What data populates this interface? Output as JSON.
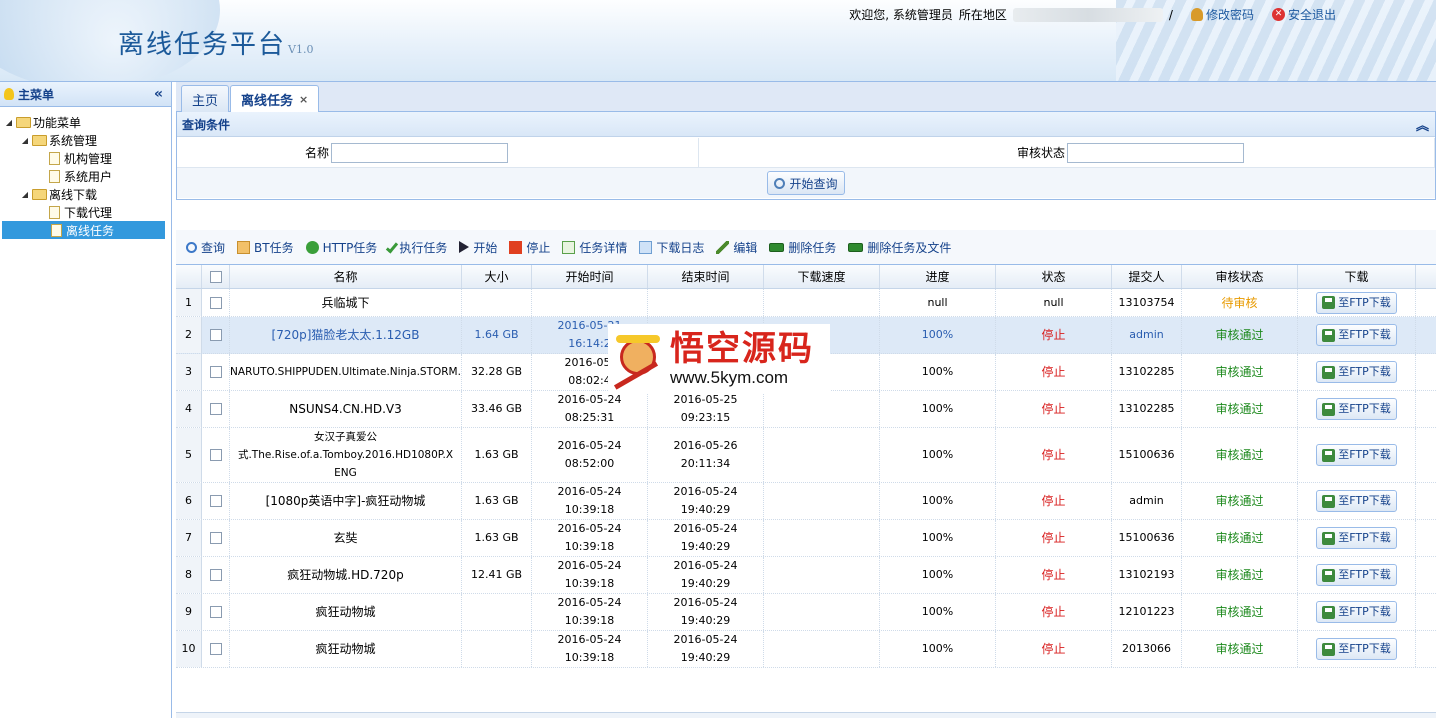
{
  "header": {
    "title": "离线任务平台",
    "version": "V1.0",
    "welcome": "欢迎您, 系统管理员",
    "region_label": "所在地区",
    "separator": "/",
    "change_password": "修改密码",
    "logout": "安全退出"
  },
  "sidebar": {
    "title": "主菜单",
    "collapse_glyph": "«",
    "tree": {
      "root": "功能菜单",
      "sys_group": "系统管理",
      "sys_items": [
        "机构管理",
        "系统用户"
      ],
      "dl_group": "离线下载",
      "dl_items": [
        "下载代理",
        "离线任务"
      ]
    }
  },
  "tabs": [
    {
      "label": "主页"
    },
    {
      "label": "离线任务",
      "close": "×"
    }
  ],
  "query": {
    "title": "查询条件",
    "name_label": "名称",
    "status_label": "审核状态",
    "search_button": "开始查询"
  },
  "toolbar": {
    "find": "查询",
    "bt": "BT任务",
    "http": "HTTP任务",
    "execute": "执行任务",
    "start": "开始",
    "stop": "停止",
    "detail": "任务详情",
    "log": "下载日志",
    "edit": "编辑",
    "delete": "删除任务",
    "delete_files": "删除任务及文件"
  },
  "grid": {
    "columns": [
      "名称",
      "大小",
      "开始时间",
      "结束时间",
      "下载速度",
      "进度",
      "状态",
      "提交人",
      "审核状态",
      "下载"
    ],
    "download_label": "至FTP下载",
    "rows": [
      {
        "num": "1",
        "name": "兵临城下",
        "size": "",
        "start": [
          "",
          ""
        ],
        "end": [
          "",
          ""
        ],
        "speed": "",
        "progress": "null",
        "status": "null",
        "submitter": "13103754",
        "audit": "待审核"
      },
      {
        "num": "2",
        "name": "[720p]猫脸老太太.1.12GB",
        "size": "1.64 GB",
        "start": [
          "2016-05-21",
          "16:14:2"
        ],
        "end": [
          "2016-05-21",
          ""
        ],
        "speed": "",
        "progress": "100%",
        "status": "停止",
        "submitter": "admin",
        "audit": "审核通过"
      },
      {
        "num": "3",
        "name": "NARUTO.SHIPPUDEN.Ultimate.Ninja.STORM.",
        "size": "32.28 GB",
        "start": [
          "2016-05-",
          "08:02:4"
        ],
        "end": [
          "",
          ""
        ],
        "speed": "",
        "progress": "100%",
        "status": "停止",
        "submitter": "13102285",
        "audit": "审核通过"
      },
      {
        "num": "4",
        "name": "NSUNS4.CN.HD.V3",
        "size": "33.46 GB",
        "start": [
          "2016-05-24",
          "08:25:31"
        ],
        "end": [
          "2016-05-25",
          "09:23:15"
        ],
        "speed": "",
        "progress": "100%",
        "status": "停止",
        "submitter": "13102285",
        "audit": "审核通过"
      },
      {
        "num": "5",
        "name": [
          "女汉子真爱公",
          "式.The.Rise.of.a.Tomboy.2016.HD1080P.X",
          "ENG"
        ],
        "size": "1.63 GB",
        "start": [
          "2016-05-24",
          "08:52:00"
        ],
        "end": [
          "2016-05-26",
          "20:11:34"
        ],
        "speed": "",
        "progress": "100%",
        "status": "停止",
        "submitter": "15100636",
        "audit": "审核通过"
      },
      {
        "num": "6",
        "name": "[1080p英语中字]-疯狂动物城",
        "size": "1.63 GB",
        "start": [
          "2016-05-24",
          "10:39:18"
        ],
        "end": [
          "2016-05-24",
          "19:40:29"
        ],
        "speed": "",
        "progress": "100%",
        "status": "停止",
        "submitter": "admin",
        "audit": "审核通过"
      },
      {
        "num": "7",
        "name": "玄奘",
        "size": "1.63 GB",
        "start": [
          "2016-05-24",
          "10:39:18"
        ],
        "end": [
          "2016-05-24",
          "19:40:29"
        ],
        "speed": "",
        "progress": "100%",
        "status": "停止",
        "submitter": "15100636",
        "audit": "审核通过"
      },
      {
        "num": "8",
        "name": "疯狂动物城.HD.720p",
        "size": "12.41 GB",
        "start": [
          "2016-05-24",
          "10:39:18"
        ],
        "end": [
          "2016-05-24",
          "19:40:29"
        ],
        "speed": "",
        "progress": "100%",
        "status": "停止",
        "submitter": "13102193",
        "audit": "审核通过"
      },
      {
        "num": "9",
        "name": "疯狂动物城",
        "size": "",
        "start": [
          "2016-05-24",
          "10:39:18"
        ],
        "end": [
          "2016-05-24",
          "19:40:29"
        ],
        "speed": "",
        "progress": "100%",
        "status": "停止",
        "submitter": "12101223",
        "audit": "审核通过"
      },
      {
        "num": "10",
        "name": "疯狂动物城",
        "size": "",
        "start": [
          "2016-05-24",
          "10:39:18"
        ],
        "end": [
          "2016-05-24",
          "19:40:29"
        ],
        "speed": "",
        "progress": "100%",
        "status": "停止",
        "submitter": "2013066",
        "audit": "审核通过"
      }
    ]
  },
  "watermark": {
    "cn": "悟空源码",
    "url": "www.5kym.com"
  },
  "colors": {
    "accent": "#15428b",
    "border": "#99bbe8",
    "stopped": "#d81e1e",
    "approved": "#1e8a1e",
    "pending": "#e89a00",
    "selected": "#3399dd"
  }
}
